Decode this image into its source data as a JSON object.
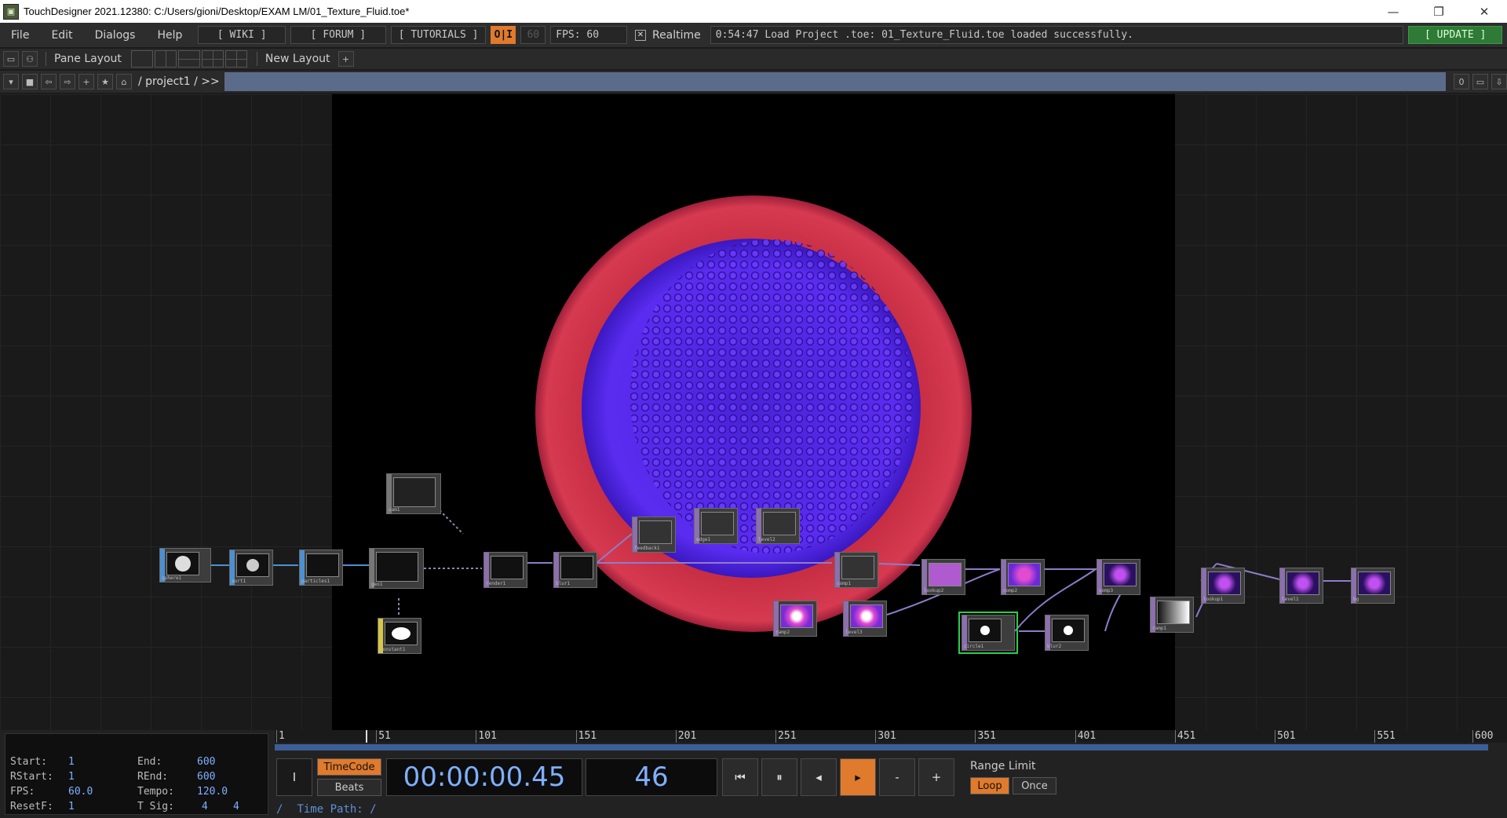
{
  "window": {
    "title": "TouchDesigner 2021.12380: C:/Users/gioni/Desktop/EXAM LM/01_Texture_Fluid.toe*"
  },
  "menu": {
    "items": [
      "File",
      "Edit",
      "Dialogs",
      "Help"
    ],
    "wiki": "[ WIKI ]",
    "forum": "[ FORUM ]",
    "tutorials": "[ TUTORIALS ]",
    "oi": "O|I",
    "fps_target": "60",
    "fps_label": "FPS:  60",
    "realtime_label": "Realtime",
    "status_message": "0:54:47 Load Project .toe: 01_Texture_Fluid.toe loaded successfully.",
    "update": "[ UPDATE ]"
  },
  "panebar": {
    "pane_layout": "Pane Layout",
    "new_layout": "New Layout",
    "add": "+"
  },
  "pathbar": {
    "path": "/ project1  /  >>",
    "counter": "0"
  },
  "nodes": [
    {
      "label": "sphere1",
      "family": "sop"
    },
    {
      "label": "sort1",
      "family": "sop"
    },
    {
      "label": "particles1",
      "family": "sop"
    },
    {
      "label": "geo1",
      "family": "comp"
    },
    {
      "label": "cam1",
      "family": "comp"
    },
    {
      "label": "constant1",
      "family": "mat"
    },
    {
      "label": "render1",
      "family": "top"
    },
    {
      "label": "blur1",
      "family": "top"
    },
    {
      "label": "feedback1",
      "family": "top"
    },
    {
      "label": "edge1",
      "family": "top"
    },
    {
      "label": "level2",
      "family": "top"
    },
    {
      "label": "comp1",
      "family": "top"
    },
    {
      "label": "ramp2",
      "family": "top"
    },
    {
      "label": "level3",
      "family": "top"
    },
    {
      "label": "lookup2",
      "family": "top"
    },
    {
      "label": "comp2",
      "family": "top"
    },
    {
      "label": "circle1",
      "family": "top"
    },
    {
      "label": "blur2",
      "family": "top"
    },
    {
      "label": "comp3",
      "family": "top"
    },
    {
      "label": "ramp1",
      "family": "top"
    },
    {
      "label": "lookup1",
      "family": "top"
    },
    {
      "label": "level1",
      "family": "top"
    },
    {
      "label": "bg",
      "family": "top"
    }
  ],
  "range": {
    "start_label": "Start:",
    "start": "1",
    "end_label": "End:",
    "end": "600",
    "rstart_label": "RStart:",
    "rstart": "1",
    "rend_label": "REnd:",
    "rend": "600",
    "fps_label": "FPS:",
    "fps": "60.0",
    "tempo_label": "Tempo:",
    "tempo": "120.0",
    "resetf_label": "ResetF:",
    "resetf": "1",
    "tsig_label": "T Sig:",
    "tsig_a": "4",
    "tsig_b": "4"
  },
  "timeline": {
    "ticks": [
      "1",
      "51",
      "101",
      "151",
      "201",
      "251",
      "301",
      "351",
      "401",
      "451",
      "501",
      "551",
      "600"
    ],
    "current_frame": 46
  },
  "transport": {
    "timecode_label": "TimeCode",
    "beats_label": "Beats",
    "timecode": "00:00:00.45",
    "frame": "46",
    "range_limit": "Range Limit",
    "loop": "Loop",
    "once": "Once",
    "minus": "-",
    "plus": "+"
  },
  "timepath": {
    "slash": "/",
    "label": "Time Path: /"
  },
  "colors": {
    "accent_orange": "#e07a2c",
    "update_green": "#2e7a36",
    "value_blue": "#7fb0ff",
    "selected_outline": "#25d04a"
  }
}
